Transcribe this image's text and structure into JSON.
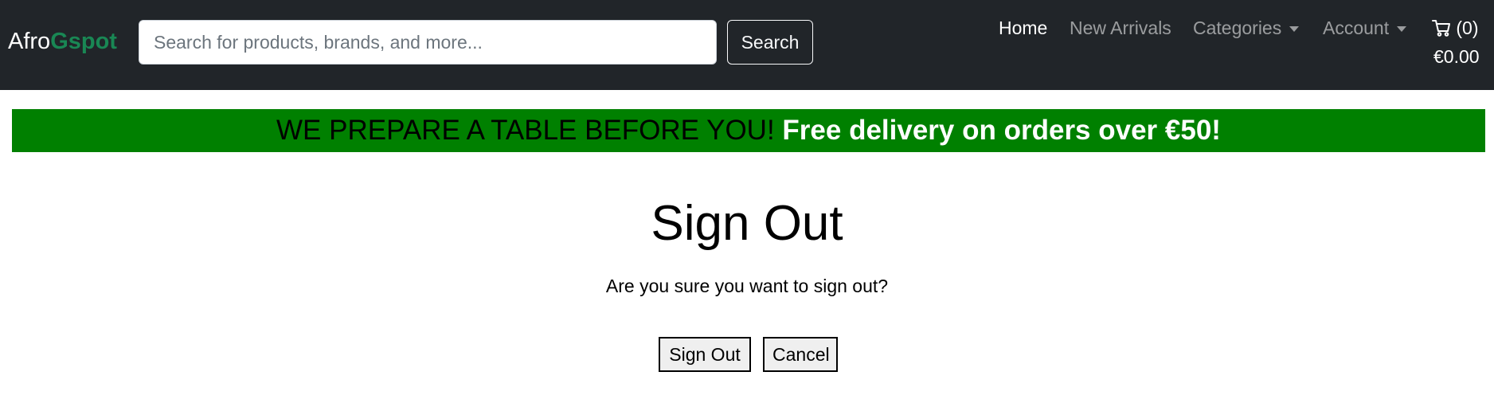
{
  "navbar": {
    "brand": {
      "prefix": "Afro",
      "accent": "Gspot"
    },
    "search": {
      "placeholder": "Search for products, brands, and more...",
      "button_label": "Search"
    },
    "links": {
      "home": "Home",
      "new_arrivals": "New Arrivals",
      "categories": "Categories",
      "account": "Account"
    },
    "cart": {
      "count": "(0)",
      "total": "€0.00",
      "icon": "cart-icon"
    }
  },
  "banner": {
    "tagline": "WE PREPARE A TABLE BEFORE YOU!",
    "promo": "Free delivery on orders over €50!"
  },
  "main": {
    "title": "Sign Out",
    "message": "Are you sure you want to sign out?",
    "signout_label": "Sign Out",
    "cancel_label": "Cancel"
  },
  "colors": {
    "navbar_bg": "#212529",
    "brand_accent": "#198754",
    "banner_bg": "#008000"
  }
}
